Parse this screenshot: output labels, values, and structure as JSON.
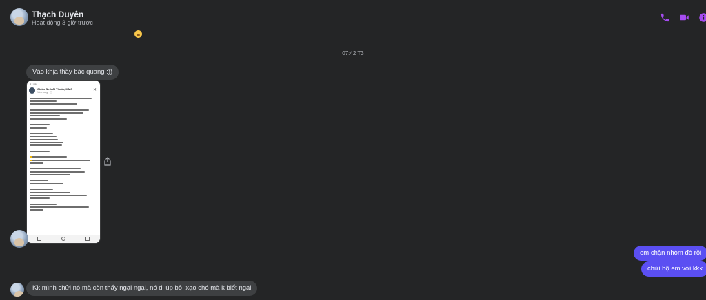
{
  "contact": {
    "name": "Thạch Duyên",
    "status": "Hoạt động 3 giờ trước"
  },
  "header_actions": [
    {
      "name": "phone-call-button",
      "icon": "phone-icon"
    },
    {
      "name": "video-call-button",
      "icon": "video-camera-icon"
    },
    {
      "name": "conversation-info-button",
      "icon": "info-icon"
    }
  ],
  "accent_color": "#a54cf0",
  "conversation": {
    "timestamp": "07:42 T3",
    "messages": {
      "incoming_1": "Vào khịa thầy bác quang :))",
      "outgoing_1": "em chặn nhóm đó rồi",
      "outgoing_2": "chửi hộ em với kkk",
      "incoming_2": "Kk mình chửi nó mà còn thấy ngại ngại, nó đi úp bô, xạo chó mà k biết ngại"
    },
    "attachment": {
      "post_author": "Chiến Binh AI Thuấn, MMO",
      "post_meta": "Vừa xong · ⓘ",
      "status_time": "07:41"
    }
  },
  "colors": {
    "background": "#242526",
    "incoming_bubble": "#3e4042",
    "outgoing_bubble": "#5b4ff2"
  }
}
